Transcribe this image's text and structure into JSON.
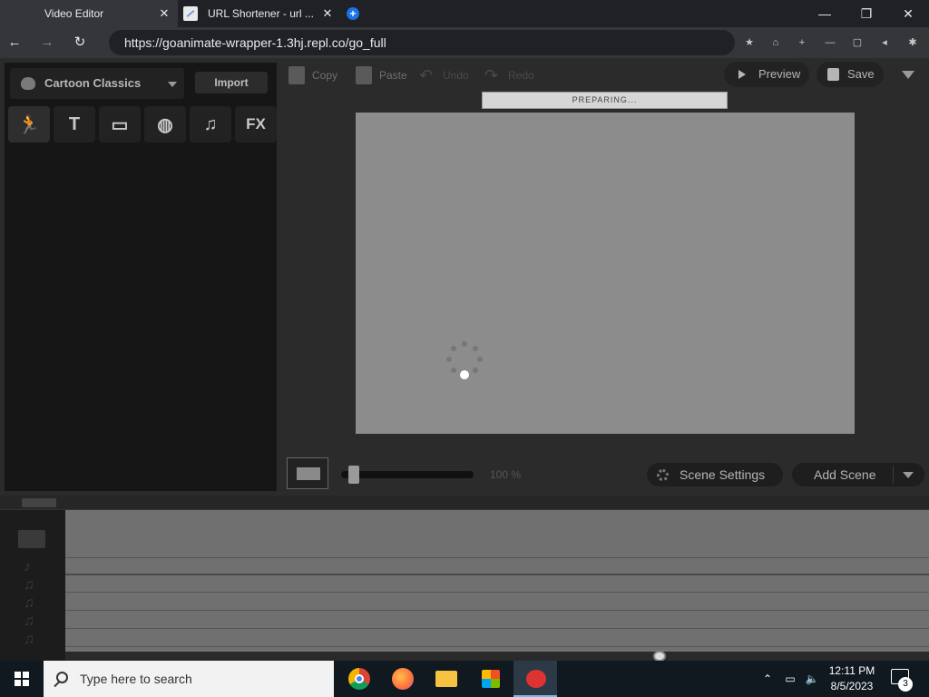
{
  "browser": {
    "tabs": [
      {
        "title": "Video Editor",
        "close": "✕"
      },
      {
        "title": "URL Shortener - url ...",
        "close": "✕"
      }
    ],
    "new_tab": "+",
    "window_controls": {
      "minimize": "—",
      "restore": "❐",
      "close": "✕"
    },
    "nav": {
      "back": "←",
      "forward": "→",
      "reload": "↻"
    },
    "url": "https://goanimate-wrapper-1.3hj.repl.co/go_full",
    "extensions": [
      "★",
      "⌂",
      "+",
      "—",
      "▢",
      "◂",
      "✱"
    ]
  },
  "left_panel": {
    "theme_label": "Cartoon Classics",
    "import_label": "Import",
    "asset_tabs": [
      {
        "name": "characters",
        "glyph": "🏃"
      },
      {
        "name": "text",
        "glyph": "T"
      },
      {
        "name": "backgrounds",
        "glyph": "▭"
      },
      {
        "name": "props",
        "glyph": "◍"
      },
      {
        "name": "music",
        "glyph": "♫"
      },
      {
        "name": "effects",
        "glyph": "FX"
      }
    ]
  },
  "toolbar": {
    "copy": "Copy",
    "paste": "Paste",
    "undo": "Undo",
    "redo": "Redo",
    "preview": "Preview",
    "save": "Save"
  },
  "stage": {
    "progress_text": "PREPARING...",
    "zoom": "100 %",
    "scene_settings": "Scene Settings",
    "add_scene": "Add Scene"
  },
  "taskbar": {
    "search_placeholder": "Type here to search",
    "time": "12:11 PM",
    "date": "8/5/2023",
    "notification_count": "3"
  },
  "colors": {
    "app_bg": "#2b2b2b",
    "canvas_bg": "#8c8c8c",
    "chrome_bg": "#202124",
    "taskbar_bg": "#101820"
  }
}
